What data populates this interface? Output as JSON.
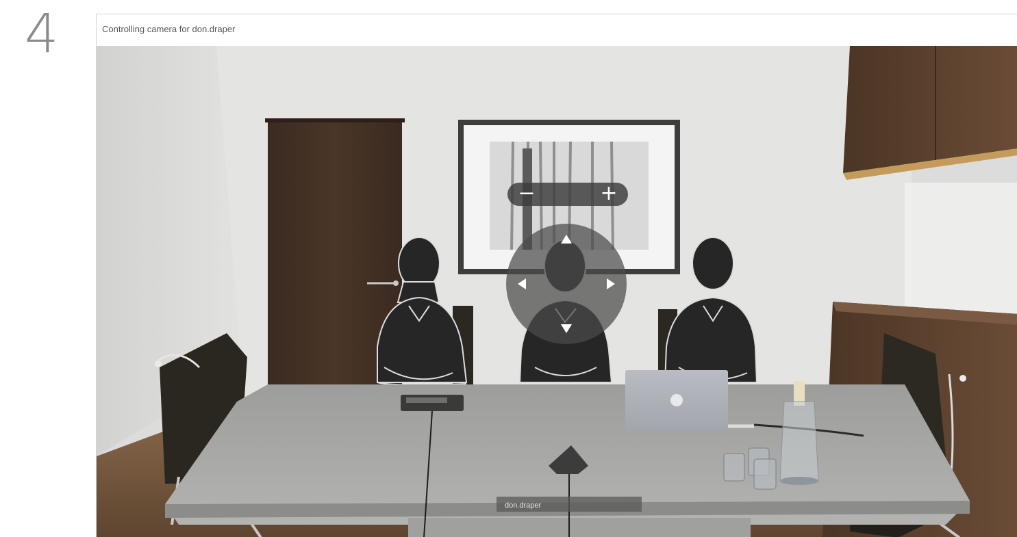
{
  "step": {
    "number": "4"
  },
  "window": {
    "title": "Controlling camera for don.draper"
  },
  "camera_controls": {
    "zoom_out_label": "−",
    "zoom_in_label": "+",
    "pan_up_icon": "triangle-up",
    "pan_down_icon": "triangle-down",
    "pan_left_icon": "triangle-left",
    "pan_right_icon": "triangle-right"
  },
  "participant": {
    "name": "don.draper"
  },
  "colors": {
    "control_bg": "#3c3c3c",
    "control_fg": "#ffffff"
  }
}
